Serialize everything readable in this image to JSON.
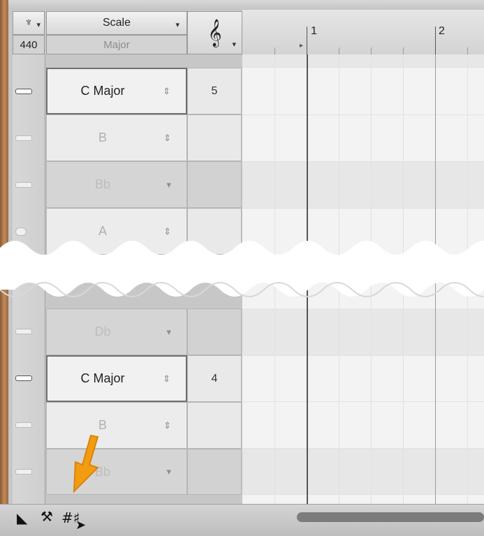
{
  "header": {
    "key_icon": "tuning-fork-icon",
    "tuning_value": "440",
    "scale_label": "Scale",
    "scale_value": "Major",
    "clef_icon": "treble-clef-icon"
  },
  "ruler": {
    "bar_numbers": [
      "1",
      "2"
    ]
  },
  "rows_top": [
    {
      "label": "C Major",
      "octave": "5",
      "style": "bold"
    },
    {
      "label": "B",
      "octave": "",
      "style": "dim"
    },
    {
      "label": "Bb",
      "octave": "",
      "style": "gray"
    },
    {
      "label": "A",
      "octave": "",
      "style": "dim"
    }
  ],
  "rows_bottom": [
    {
      "label": "Db",
      "octave": "",
      "style": "gray"
    },
    {
      "label": "C Major",
      "octave": "4",
      "style": "bold"
    },
    {
      "label": "B",
      "octave": "",
      "style": "dim"
    },
    {
      "label": "Bb",
      "octave": "",
      "style": "gray"
    }
  ],
  "toolbar": {
    "tools": [
      "pointer-tool-icon",
      "wrench-tool-icon",
      "scale-tool-icon"
    ]
  },
  "colors": {
    "highlight_arrow": "#f39c12"
  }
}
